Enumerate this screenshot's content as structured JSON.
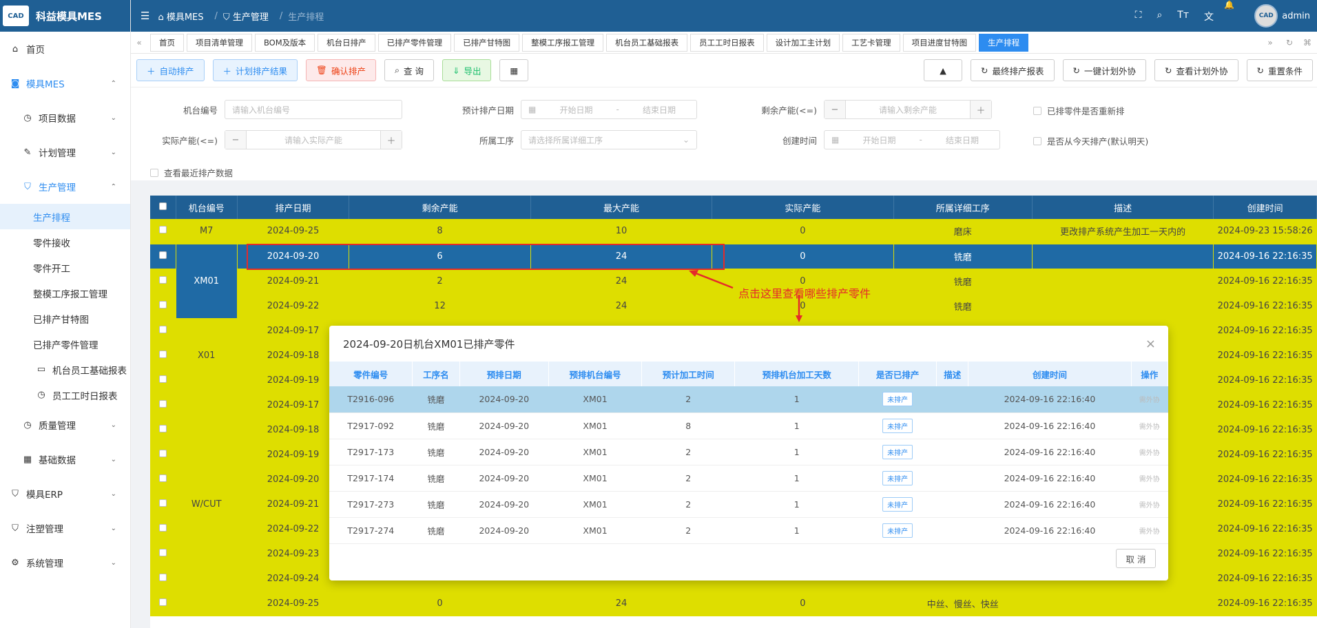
{
  "app": {
    "title": "科益模具MES",
    "logo_text": "CAD"
  },
  "sidebar": {
    "items": [
      {
        "label": "首页",
        "icon": "home-icon",
        "level": 0
      },
      {
        "label": "模具MES",
        "icon": "camera-icon",
        "level": 0,
        "active": true,
        "chev": "up"
      },
      {
        "label": "项目数据",
        "icon": "clock-icon",
        "level": 1,
        "chev": "down"
      },
      {
        "label": "计划管理",
        "icon": "edit-icon",
        "level": 1,
        "chev": "down"
      },
      {
        "label": "生产管理",
        "icon": "shield-icon",
        "level": 1,
        "active": true,
        "chev": "up"
      },
      {
        "label": "生产排程",
        "icon": "",
        "level": 2,
        "selected": true
      },
      {
        "label": "零件接收",
        "icon": "",
        "level": 2
      },
      {
        "label": "零件开工",
        "icon": "",
        "level": 2
      },
      {
        "label": "整模工序报工管理",
        "icon": "",
        "level": 2
      },
      {
        "label": "已排产甘特图",
        "icon": "",
        "level": 2
      },
      {
        "label": "已排产零件管理",
        "icon": "",
        "level": 2
      },
      {
        "label": "机台员工基础报表",
        "icon": "monitor-icon",
        "level": 3
      },
      {
        "label": "员工工时日报表",
        "icon": "clock-icon",
        "level": 3
      },
      {
        "label": "质量管理",
        "icon": "clock-icon",
        "level": 1,
        "chev": "down"
      },
      {
        "label": "基础数据",
        "icon": "table-icon",
        "level": 1,
        "chev": "down"
      },
      {
        "label": "模具ERP",
        "icon": "shield-icon",
        "level": 0,
        "chev": "down"
      },
      {
        "label": "注塑管理",
        "icon": "shield-icon",
        "level": 0,
        "chev": "down"
      },
      {
        "label": "系统管理",
        "icon": "gear-icon",
        "level": 0,
        "chev": "down"
      }
    ]
  },
  "header": {
    "crumbs": [
      "模具MES",
      "生产管理",
      "生产排程"
    ],
    "user": "admin"
  },
  "tabs": [
    "首页",
    "项目清单管理",
    "BOM及版本",
    "机台日排产",
    "已排产零件管理",
    "已排产甘特图",
    "整模工序报工管理",
    "机台员工基础报表",
    "员工工时日报表",
    "设计加工主计划",
    "工艺卡管理",
    "项目进度甘特图",
    "生产排程"
  ],
  "toolbar": {
    "left": [
      "自动排产",
      "计划排产结果",
      "确认排产",
      "查 询",
      "导出"
    ],
    "right": [
      "最终排产报表",
      "一键计划外协",
      "查看计划外协",
      "重置条件"
    ]
  },
  "filters": {
    "machine_label": "机台编号",
    "machine_ph": "请输入机台编号",
    "date_label": "预计排产日期",
    "start_ph": "开始日期",
    "end_ph": "结束日期",
    "remain_label": "剩余产能(<=)",
    "remain_ph": "请输入剩余产能",
    "rerun_label": "已排零件是否重新排",
    "actual_label": "实际产能(<=)",
    "actual_ph": "请输入实际产能",
    "proc_label": "所属工序",
    "proc_ph": "请选择所属详细工序",
    "created_label": "创建时间",
    "today_label": "是否从今天排产(默认明天)",
    "recent_label": "查看最近排产数据"
  },
  "table": {
    "headers": [
      "机台编号",
      "排产日期",
      "剩余产能",
      "最大产能",
      "实际产能",
      "所属详细工序",
      "描述",
      "创建时间"
    ],
    "rows": [
      {
        "m": "M7",
        "d": "2024-09-25",
        "r": "8",
        "max": "10",
        "a": "0",
        "p": "磨床",
        "desc": "更改排产系统产生加工一天内的",
        "c": "2024-09-23 15:58:26"
      },
      {
        "m": "XM01",
        "d": "2024-09-20",
        "r": "6",
        "max": "24",
        "a": "0",
        "p": "铣磨",
        "desc": "",
        "c": "2024-09-16 22:16:35"
      },
      {
        "m": "",
        "d": "2024-09-21",
        "r": "2",
        "max": "24",
        "a": "0",
        "p": "铣磨",
        "desc": "",
        "c": "2024-09-16 22:16:35"
      },
      {
        "m": "",
        "d": "2024-09-22",
        "r": "12",
        "max": "24",
        "a": "0",
        "p": "铣磨",
        "desc": "",
        "c": "2024-09-16 22:16:35"
      },
      {
        "m": "X01",
        "d": "2024-09-17",
        "r": "",
        "max": "",
        "a": "",
        "p": "",
        "desc": "",
        "c": "2024-09-16 22:16:35"
      },
      {
        "m": "",
        "d": "2024-09-18",
        "r": "",
        "max": "",
        "a": "",
        "p": "",
        "desc": "",
        "c": "2024-09-16 22:16:35"
      },
      {
        "m": "",
        "d": "2024-09-19",
        "r": "",
        "max": "",
        "a": "",
        "p": "",
        "desc": "",
        "c": "2024-09-16 22:16:35"
      },
      {
        "m": "W/CUT",
        "d": "2024-09-17",
        "r": "",
        "max": "",
        "a": "",
        "p": "",
        "desc": "",
        "c": "2024-09-16 22:16:35"
      },
      {
        "m": "",
        "d": "2024-09-18",
        "r": "",
        "max": "",
        "a": "",
        "p": "",
        "desc": "",
        "c": "2024-09-16 22:16:35"
      },
      {
        "m": "",
        "d": "2024-09-19",
        "r": "",
        "max": "",
        "a": "",
        "p": "",
        "desc": "",
        "c": "2024-09-16 22:16:35"
      },
      {
        "m": "",
        "d": "2024-09-20",
        "r": "",
        "max": "",
        "a": "",
        "p": "",
        "desc": "",
        "c": "2024-09-16 22:16:35"
      },
      {
        "m": "",
        "d": "2024-09-21",
        "r": "",
        "max": "",
        "a": "",
        "p": "",
        "desc": "",
        "c": "2024-09-16 22:16:35"
      },
      {
        "m": "",
        "d": "2024-09-22",
        "r": "",
        "max": "",
        "a": "",
        "p": "",
        "desc": "",
        "c": "2024-09-16 22:16:35"
      },
      {
        "m": "",
        "d": "2024-09-23",
        "r": "",
        "max": "",
        "a": "",
        "p": "",
        "desc": "",
        "c": "2024-09-16 22:16:35"
      },
      {
        "m": "",
        "d": "2024-09-24",
        "r": "",
        "max": "",
        "a": "",
        "p": "",
        "desc": "",
        "c": "2024-09-16 22:16:35"
      },
      {
        "m": "",
        "d": "2024-09-25",
        "r": "0",
        "max": "24",
        "a": "0",
        "p": "中丝、慢丝、快丝",
        "desc": "",
        "c": "2024-09-16 22:16:35"
      }
    ]
  },
  "annotation": "点击这里查看哪些排产零件",
  "modal": {
    "title": "2024-09-20日机台XM01已排产零件",
    "headers": [
      "零件编号",
      "工序名",
      "预排日期",
      "预排机台编号",
      "预计加工时间",
      "预排机台加工天数",
      "是否已排产",
      "描述",
      "创建时间",
      "操作"
    ],
    "rows": [
      [
        "T2916-096",
        "铣磨",
        "2024-09-20",
        "XM01",
        "2",
        "1",
        "未排产",
        "",
        "2024-09-16 22:16:40",
        "需外协"
      ],
      [
        "T2917-092",
        "铣磨",
        "2024-09-20",
        "XM01",
        "8",
        "1",
        "未排产",
        "",
        "2024-09-16 22:16:40",
        "需外协"
      ],
      [
        "T2917-173",
        "铣磨",
        "2024-09-20",
        "XM01",
        "2",
        "1",
        "未排产",
        "",
        "2024-09-16 22:16:40",
        "需外协"
      ],
      [
        "T2917-174",
        "铣磨",
        "2024-09-20",
        "XM01",
        "2",
        "1",
        "未排产",
        "",
        "2024-09-16 22:16:40",
        "需外协"
      ],
      [
        "T2917-273",
        "铣磨",
        "2024-09-20",
        "XM01",
        "2",
        "1",
        "未排产",
        "",
        "2024-09-16 22:16:40",
        "需外协"
      ],
      [
        "T2917-274",
        "铣磨",
        "2024-09-20",
        "XM01",
        "2",
        "1",
        "未排产",
        "",
        "2024-09-16 22:16:40",
        "需外协"
      ]
    ],
    "cancel": "取 消"
  }
}
